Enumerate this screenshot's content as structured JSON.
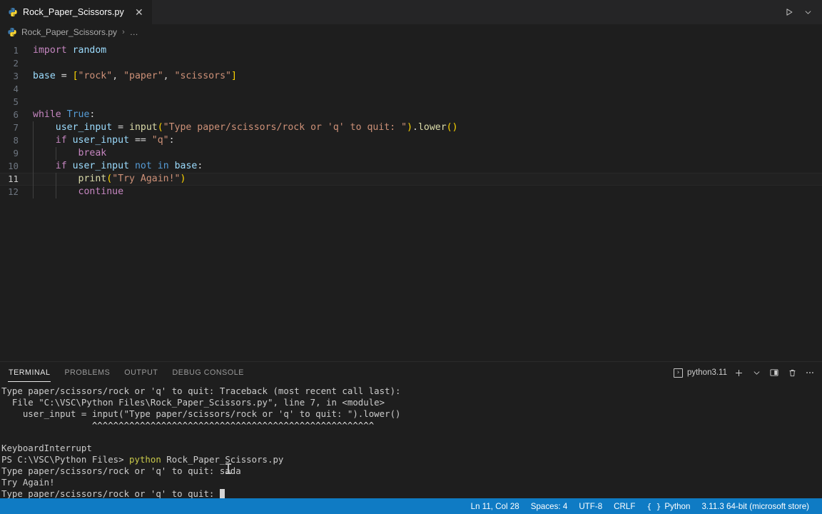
{
  "window": {
    "theme_bg": "#1e1e1e",
    "accent": "#0f7bc4"
  },
  "tabbar": {
    "tabs": [
      {
        "label": "Rock_Paper_Scissors.py",
        "icon": "python-file-icon",
        "close": "✕",
        "active": true
      }
    ],
    "actions": [
      {
        "name": "run-python-file-button",
        "glyph": "▷"
      },
      {
        "name": "run-options-chevron-down-icon",
        "glyph": "∨"
      }
    ]
  },
  "breadcrumb": {
    "icon": "python-file-icon",
    "file": "Rock_Paper_Scissors.py",
    "separator": "›",
    "more": "…"
  },
  "editor": {
    "language": "Python",
    "active_line": 11,
    "lines": [
      {
        "n": "1",
        "indent_guides": 0,
        "tokens": [
          {
            "t": "import",
            "c": "t-kw"
          },
          {
            "t": " ",
            "c": "t-plain"
          },
          {
            "t": "random",
            "c": "t-var"
          }
        ]
      },
      {
        "n": "2",
        "indent_guides": 0,
        "tokens": []
      },
      {
        "n": "3",
        "indent_guides": 0,
        "tokens": [
          {
            "t": "base",
            "c": "t-var"
          },
          {
            "t": " = ",
            "c": "t-op"
          },
          {
            "t": "[",
            "c": "t-brk"
          },
          {
            "t": "\"rock\"",
            "c": "t-str"
          },
          {
            "t": ", ",
            "c": "t-plain"
          },
          {
            "t": "\"paper\"",
            "c": "t-str"
          },
          {
            "t": ", ",
            "c": "t-plain"
          },
          {
            "t": "\"scissors\"",
            "c": "t-str"
          },
          {
            "t": "]",
            "c": "t-brk"
          }
        ]
      },
      {
        "n": "4",
        "indent_guides": 0,
        "tokens": []
      },
      {
        "n": "5",
        "indent_guides": 0,
        "tokens": []
      },
      {
        "n": "6",
        "indent_guides": 0,
        "tokens": [
          {
            "t": "while",
            "c": "t-kw"
          },
          {
            "t": " ",
            "c": "t-plain"
          },
          {
            "t": "True",
            "c": "t-kw2"
          },
          {
            "t": ":",
            "c": "t-plain"
          }
        ]
      },
      {
        "n": "7",
        "indent_guides": 1,
        "tokens": [
          {
            "t": "    ",
            "c": "t-plain"
          },
          {
            "t": "user_input",
            "c": "t-var"
          },
          {
            "t": " = ",
            "c": "t-op"
          },
          {
            "t": "input",
            "c": "t-fn"
          },
          {
            "t": "(",
            "c": "t-brk"
          },
          {
            "t": "\"Type paper/scissors/rock or 'q' to quit: \"",
            "c": "t-str"
          },
          {
            "t": ")",
            "c": "t-brk"
          },
          {
            "t": ".",
            "c": "t-plain"
          },
          {
            "t": "lower",
            "c": "t-fn"
          },
          {
            "t": "()",
            "c": "t-brk"
          }
        ]
      },
      {
        "n": "8",
        "indent_guides": 1,
        "tokens": [
          {
            "t": "    ",
            "c": "t-plain"
          },
          {
            "t": "if",
            "c": "t-kw"
          },
          {
            "t": " ",
            "c": "t-plain"
          },
          {
            "t": "user_input",
            "c": "t-var"
          },
          {
            "t": " == ",
            "c": "t-op"
          },
          {
            "t": "\"q\"",
            "c": "t-str"
          },
          {
            "t": ":",
            "c": "t-plain"
          }
        ]
      },
      {
        "n": "9",
        "indent_guides": 2,
        "tokens": [
          {
            "t": "        ",
            "c": "t-plain"
          },
          {
            "t": "break",
            "c": "t-kw"
          }
        ]
      },
      {
        "n": "10",
        "indent_guides": 1,
        "tokens": [
          {
            "t": "    ",
            "c": "t-plain"
          },
          {
            "t": "if",
            "c": "t-kw"
          },
          {
            "t": " ",
            "c": "t-plain"
          },
          {
            "t": "user_input",
            "c": "t-var"
          },
          {
            "t": " ",
            "c": "t-plain"
          },
          {
            "t": "not",
            "c": "t-kw2"
          },
          {
            "t": " ",
            "c": "t-plain"
          },
          {
            "t": "in",
            "c": "t-kw2"
          },
          {
            "t": " ",
            "c": "t-plain"
          },
          {
            "t": "base",
            "c": "t-var"
          },
          {
            "t": ":",
            "c": "t-plain"
          }
        ]
      },
      {
        "n": "11",
        "indent_guides": 2,
        "tokens": [
          {
            "t": "        ",
            "c": "t-plain"
          },
          {
            "t": "print",
            "c": "t-fn"
          },
          {
            "t": "(",
            "c": "t-brk"
          },
          {
            "t": "\"Try Again!\"",
            "c": "t-str"
          },
          {
            "t": ")",
            "c": "t-brk"
          }
        ]
      },
      {
        "n": "12",
        "indent_guides": 2,
        "tokens": [
          {
            "t": "        ",
            "c": "t-plain"
          },
          {
            "t": "continue",
            "c": "t-kw"
          }
        ]
      }
    ]
  },
  "panel": {
    "tabs": [
      {
        "label": "TERMINAL",
        "active": true
      },
      {
        "label": "PROBLEMS",
        "active": false
      },
      {
        "label": "OUTPUT",
        "active": false
      },
      {
        "label": "DEBUG CONSOLE",
        "active": false
      }
    ],
    "terminal_name": "python3.11",
    "terminal_icon_glyph": "›",
    "actions": [
      {
        "name": "new-terminal-button",
        "glyph": "+"
      },
      {
        "name": "terminal-profile-chevron-down-icon",
        "glyph": "∨"
      },
      {
        "name": "split-terminal-button",
        "glyph": "split"
      },
      {
        "name": "kill-terminal-button",
        "glyph": "trash"
      },
      {
        "name": "panel-more-actions-button",
        "glyph": "⋯"
      }
    ],
    "terminal_lines": [
      {
        "segments": [
          {
            "text": "Type paper/scissors/rock or 'q' to quit: Traceback (most recent call last):",
            "c": "tc-default"
          }
        ]
      },
      {
        "segments": [
          {
            "text": "  File \"C:\\VSC\\Python Files\\Rock_Paper_Scissors.py\", line 7, in <module>",
            "c": "tc-default"
          }
        ]
      },
      {
        "segments": [
          {
            "text": "    user_input = input(\"Type paper/scissors/rock or 'q' to quit: \").lower()",
            "c": "tc-default"
          }
        ]
      },
      {
        "segments": [
          {
            "text": "                 ^^^^^^^^^^^^^^^^^^^^^^^^^^^^^^^^^^^^^^^^^^^^^^^^^^^^^",
            "c": "tc-white"
          }
        ]
      },
      {
        "segments": [
          {
            "text": "",
            "c": "tc-default"
          }
        ]
      },
      {
        "segments": [
          {
            "text": "KeyboardInterrupt",
            "c": "tc-default"
          }
        ]
      },
      {
        "segments": [
          {
            "text": "PS C:\\VSC\\Python Files> ",
            "c": "tc-default"
          },
          {
            "text": "python",
            "c": "tc-yellow"
          },
          {
            "text": " Rock_Paper_Scissors.py",
            "c": "tc-default"
          }
        ]
      },
      {
        "segments": [
          {
            "text": "Type paper/scissors/rock or 'q' to quit: sada",
            "c": "tc-default"
          }
        ]
      },
      {
        "segments": [
          {
            "text": "Try Again!",
            "c": "tc-default"
          }
        ]
      },
      {
        "segments": [
          {
            "text": "Type paper/scissors/rock or 'q' to quit: ",
            "c": "tc-default"
          }
        ],
        "cursor": true
      }
    ]
  },
  "statusbar": {
    "items": [
      {
        "name": "editor-position",
        "label": "Ln 11, Col 28"
      },
      {
        "name": "editor-indentation",
        "label": "Spaces: 4"
      },
      {
        "name": "editor-encoding",
        "label": "UTF-8"
      },
      {
        "name": "editor-eol",
        "label": "CRLF"
      },
      {
        "name": "editor-language-mode",
        "label": "Python",
        "icon": "braces-icon"
      },
      {
        "name": "python-interpreter-version",
        "label": "3.11.3 64-bit (microsoft store)"
      }
    ]
  }
}
